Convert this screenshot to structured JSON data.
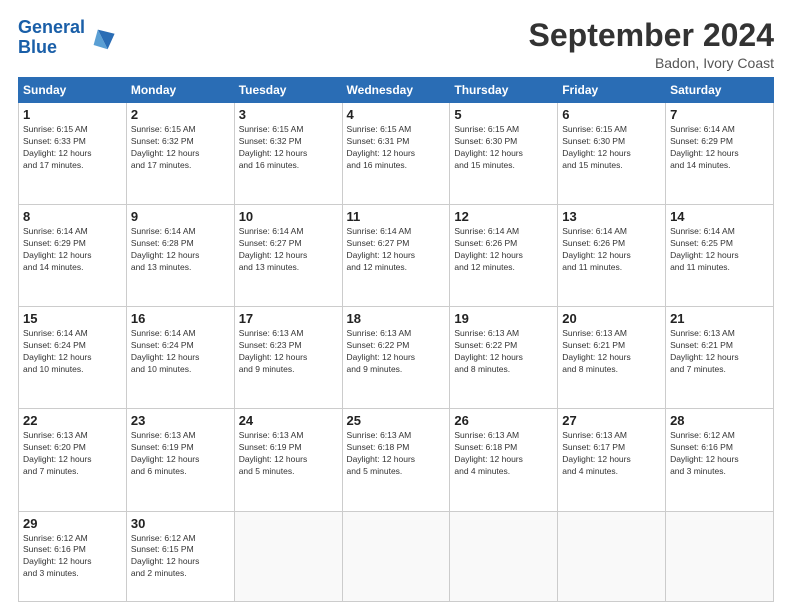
{
  "logo": {
    "text1": "General",
    "text2": "Blue"
  },
  "title": "September 2024",
  "subtitle": "Badon, Ivory Coast",
  "headers": [
    "Sunday",
    "Monday",
    "Tuesday",
    "Wednesday",
    "Thursday",
    "Friday",
    "Saturday"
  ],
  "weeks": [
    [
      {
        "day": "1",
        "sunrise": "6:15 AM",
        "sunset": "6:33 PM",
        "daylight": "12 hours and 17 minutes."
      },
      {
        "day": "2",
        "sunrise": "6:15 AM",
        "sunset": "6:32 PM",
        "daylight": "12 hours and 17 minutes."
      },
      {
        "day": "3",
        "sunrise": "6:15 AM",
        "sunset": "6:32 PM",
        "daylight": "12 hours and 16 minutes."
      },
      {
        "day": "4",
        "sunrise": "6:15 AM",
        "sunset": "6:31 PM",
        "daylight": "12 hours and 16 minutes."
      },
      {
        "day": "5",
        "sunrise": "6:15 AM",
        "sunset": "6:30 PM",
        "daylight": "12 hours and 15 minutes."
      },
      {
        "day": "6",
        "sunrise": "6:15 AM",
        "sunset": "6:30 PM",
        "daylight": "12 hours and 15 minutes."
      },
      {
        "day": "7",
        "sunrise": "6:14 AM",
        "sunset": "6:29 PM",
        "daylight": "12 hours and 14 minutes."
      }
    ],
    [
      {
        "day": "8",
        "sunrise": "6:14 AM",
        "sunset": "6:29 PM",
        "daylight": "12 hours and 14 minutes."
      },
      {
        "day": "9",
        "sunrise": "6:14 AM",
        "sunset": "6:28 PM",
        "daylight": "12 hours and 13 minutes."
      },
      {
        "day": "10",
        "sunrise": "6:14 AM",
        "sunset": "6:27 PM",
        "daylight": "12 hours and 13 minutes."
      },
      {
        "day": "11",
        "sunrise": "6:14 AM",
        "sunset": "6:27 PM",
        "daylight": "12 hours and 12 minutes."
      },
      {
        "day": "12",
        "sunrise": "6:14 AM",
        "sunset": "6:26 PM",
        "daylight": "12 hours and 12 minutes."
      },
      {
        "day": "13",
        "sunrise": "6:14 AM",
        "sunset": "6:26 PM",
        "daylight": "12 hours and 11 minutes."
      },
      {
        "day": "14",
        "sunrise": "6:14 AM",
        "sunset": "6:25 PM",
        "daylight": "12 hours and 11 minutes."
      }
    ],
    [
      {
        "day": "15",
        "sunrise": "6:14 AM",
        "sunset": "6:24 PM",
        "daylight": "12 hours and 10 minutes."
      },
      {
        "day": "16",
        "sunrise": "6:14 AM",
        "sunset": "6:24 PM",
        "daylight": "12 hours and 10 minutes."
      },
      {
        "day": "17",
        "sunrise": "6:13 AM",
        "sunset": "6:23 PM",
        "daylight": "12 hours and 9 minutes."
      },
      {
        "day": "18",
        "sunrise": "6:13 AM",
        "sunset": "6:22 PM",
        "daylight": "12 hours and 9 minutes."
      },
      {
        "day": "19",
        "sunrise": "6:13 AM",
        "sunset": "6:22 PM",
        "daylight": "12 hours and 8 minutes."
      },
      {
        "day": "20",
        "sunrise": "6:13 AM",
        "sunset": "6:21 PM",
        "daylight": "12 hours and 8 minutes."
      },
      {
        "day": "21",
        "sunrise": "6:13 AM",
        "sunset": "6:21 PM",
        "daylight": "12 hours and 7 minutes."
      }
    ],
    [
      {
        "day": "22",
        "sunrise": "6:13 AM",
        "sunset": "6:20 PM",
        "daylight": "12 hours and 7 minutes."
      },
      {
        "day": "23",
        "sunrise": "6:13 AM",
        "sunset": "6:19 PM",
        "daylight": "12 hours and 6 minutes."
      },
      {
        "day": "24",
        "sunrise": "6:13 AM",
        "sunset": "6:19 PM",
        "daylight": "12 hours and 5 minutes."
      },
      {
        "day": "25",
        "sunrise": "6:13 AM",
        "sunset": "6:18 PM",
        "daylight": "12 hours and 5 minutes."
      },
      {
        "day": "26",
        "sunrise": "6:13 AM",
        "sunset": "6:18 PM",
        "daylight": "12 hours and 4 minutes."
      },
      {
        "day": "27",
        "sunrise": "6:13 AM",
        "sunset": "6:17 PM",
        "daylight": "12 hours and 4 minutes."
      },
      {
        "day": "28",
        "sunrise": "6:12 AM",
        "sunset": "6:16 PM",
        "daylight": "12 hours and 3 minutes."
      }
    ],
    [
      {
        "day": "29",
        "sunrise": "6:12 AM",
        "sunset": "6:16 PM",
        "daylight": "12 hours and 3 minutes."
      },
      {
        "day": "30",
        "sunrise": "6:12 AM",
        "sunset": "6:15 PM",
        "daylight": "12 hours and 2 minutes."
      },
      null,
      null,
      null,
      null,
      null
    ]
  ],
  "labels": {
    "sunrise": "Sunrise:",
    "sunset": "Sunset:",
    "daylight": "Daylight:"
  }
}
